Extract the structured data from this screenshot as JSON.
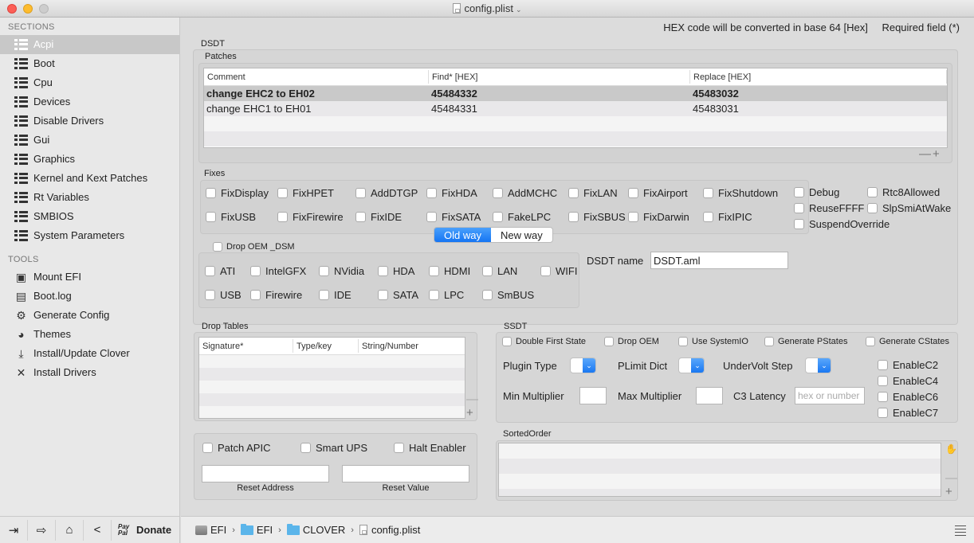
{
  "window": {
    "title": "config.plist"
  },
  "sidebar": {
    "sections_header": "SECTIONS",
    "sections": [
      {
        "label": "Acpi",
        "icon": "list-icon",
        "active": true
      },
      {
        "label": "Boot",
        "icon": "list-icon"
      },
      {
        "label": "Cpu",
        "icon": "list-icon"
      },
      {
        "label": "Devices",
        "icon": "list-icon"
      },
      {
        "label": "Disable Drivers",
        "icon": "list-icon"
      },
      {
        "label": "Gui",
        "icon": "list-icon"
      },
      {
        "label": "Graphics",
        "icon": "list-icon"
      },
      {
        "label": "Kernel and Kext Patches",
        "icon": "list-icon"
      },
      {
        "label": "Rt Variables",
        "icon": "list-icon"
      },
      {
        "label": "SMBIOS",
        "icon": "list-icon"
      },
      {
        "label": "System Parameters",
        "icon": "list-icon"
      }
    ],
    "tools_header": "TOOLS",
    "tools": [
      {
        "label": "Mount EFI",
        "icon": "disk-icon",
        "glyph": "▣"
      },
      {
        "label": "Boot.log",
        "icon": "laptop-icon",
        "glyph": "▤"
      },
      {
        "label": "Generate Config",
        "icon": "gear-icon",
        "glyph": "⚙"
      },
      {
        "label": "Themes",
        "icon": "palette-icon",
        "glyph": "◕"
      },
      {
        "label": "Install/Update Clover",
        "icon": "download-icon",
        "glyph": "⤓"
      },
      {
        "label": "Install Drivers",
        "icon": "tools-icon",
        "glyph": "✕"
      }
    ],
    "bottom": {
      "buttons": [
        {
          "name": "import-icon",
          "glyph": "⇥"
        },
        {
          "name": "export-icon",
          "glyph": "⇨"
        },
        {
          "name": "home-icon",
          "glyph": "⌂"
        },
        {
          "name": "share-icon",
          "glyph": "<"
        }
      ],
      "paypal": "Pay Pal",
      "donate": "Donate"
    }
  },
  "pathbar": {
    "segments": [
      "EFI",
      "EFI",
      "CLOVER",
      "config.plist"
    ],
    "separator": "›"
  },
  "header_note": {
    "hex_note": "HEX code will be converted in base 64 [Hex]",
    "required_note": "Required field (*)"
  },
  "dsdt": {
    "title": "DSDT",
    "patches": {
      "title": "Patches",
      "columns": [
        "Comment",
        "Find* [HEX]",
        "Replace [HEX]"
      ],
      "rows": [
        {
          "comment": "change EHC2 to EH02",
          "find": "45484332",
          "replace": "45483032",
          "selected": true
        },
        {
          "comment": "change EHC1 to EH01",
          "find": "45484331",
          "replace": "45483031",
          "selected": false
        }
      ],
      "remove": "—",
      "add": "+"
    },
    "fixes": {
      "title": "Fixes",
      "items": [
        "FixDisplay",
        "FixHPET",
        "AddDTGP",
        "FixHDA",
        "AddMCHC",
        "FixLAN",
        "FixAirport",
        "FixShutdown",
        "FixUSB",
        "FixFirewire",
        "FixIDE",
        "FixSATA",
        "FakeLPC",
        "FixSBUS",
        "FixDarwin",
        "FixIPIC"
      ],
      "extra": [
        "Debug",
        "Rtc8Allowed",
        "ReuseFFFF",
        "SlpSmiAtWake",
        "SuspendOverride"
      ]
    },
    "mode": {
      "options": [
        "Old way",
        "New way"
      ],
      "selected": "Old way"
    },
    "drop_oem_dsm": {
      "label": "Drop OEM _DSM",
      "items": [
        "ATI",
        "IntelGFX",
        "NVidia",
        "HDA",
        "HDMI",
        "LAN",
        "WIFI",
        "USB",
        "Firewire",
        "IDE",
        "SATA",
        "LPC",
        "SmBUS"
      ]
    },
    "dsdt_name": {
      "label": "DSDT name",
      "value": "DSDT.aml"
    }
  },
  "drop_tables": {
    "title": "Drop Tables",
    "columns": [
      "Signature*",
      "Type/key",
      "String/Number"
    ],
    "remove": "—",
    "add": "+"
  },
  "misc": {
    "checkboxes": [
      "Patch APIC",
      "Smart UPS",
      "Halt Enabler"
    ],
    "reset_address": {
      "label": "Reset Address",
      "value": ""
    },
    "reset_value": {
      "label": "Reset Value",
      "value": ""
    }
  },
  "ssdt": {
    "title": "SSDT",
    "checkboxes": [
      "Double First State",
      "Drop OEM",
      "Use SystemIO",
      "Generate PStates",
      "Generate CStates"
    ],
    "plugin_type": {
      "label": "Plugin Type",
      "value": ""
    },
    "plimit_dict": {
      "label": "PLimit Dict",
      "value": ""
    },
    "undervolt_step": {
      "label": "UnderVolt Step",
      "value": ""
    },
    "min_multiplier": {
      "label": "Min Multiplier",
      "value": ""
    },
    "max_multiplier": {
      "label": "Max Multiplier",
      "value": ""
    },
    "c3_latency": {
      "label": "C3 Latency",
      "placeholder": "hex or number",
      "value": ""
    },
    "enable_c": [
      "EnableC2",
      "EnableC4",
      "EnableC6",
      "EnableC7"
    ]
  },
  "sorted_order": {
    "title": "SortedOrder",
    "remove": "—",
    "add": "+"
  }
}
